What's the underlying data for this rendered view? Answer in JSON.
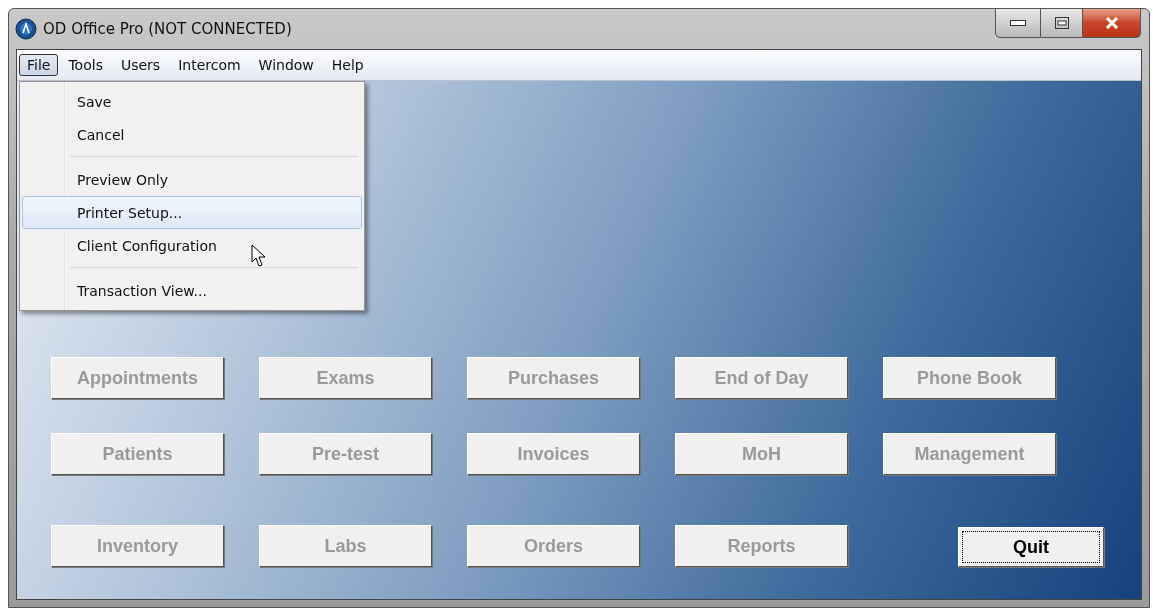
{
  "window": {
    "title": "OD Office Pro (NOT CONNECTED)"
  },
  "menu_bar": [
    {
      "label": "File",
      "selected": true
    },
    {
      "label": "Tools",
      "selected": false
    },
    {
      "label": "Users",
      "selected": false
    },
    {
      "label": "Intercom",
      "selected": false
    },
    {
      "label": "Window",
      "selected": false
    },
    {
      "label": "Help",
      "selected": false
    }
  ],
  "file_menu": [
    {
      "kind": "item",
      "label": "Save",
      "selected": false
    },
    {
      "kind": "item",
      "label": "Cancel",
      "selected": false
    },
    {
      "kind": "separator"
    },
    {
      "kind": "item",
      "label": "Preview Only",
      "selected": false
    },
    {
      "kind": "item",
      "label": "Printer Setup...",
      "selected": true
    },
    {
      "kind": "item",
      "label": "Client Configuration",
      "selected": false
    },
    {
      "kind": "separator"
    },
    {
      "kind": "item",
      "label": "Transaction View...",
      "selected": false
    }
  ],
  "button_rows": [
    [
      {
        "label": "Appointments",
        "disabled": true,
        "focused": false
      },
      {
        "label": "Exams",
        "disabled": true,
        "focused": false
      },
      {
        "label": "Purchases",
        "disabled": true,
        "focused": false
      },
      {
        "label": "End of Day",
        "disabled": true,
        "focused": false
      },
      {
        "label": "Phone Book",
        "disabled": true,
        "focused": false
      }
    ],
    [
      {
        "label": "Patients",
        "disabled": true,
        "focused": false
      },
      {
        "label": "Pre-test",
        "disabled": true,
        "focused": false
      },
      {
        "label": "Invoices",
        "disabled": true,
        "focused": false
      },
      {
        "label": "MoH",
        "disabled": true,
        "focused": false
      },
      {
        "label": "Management",
        "disabled": true,
        "focused": false
      }
    ],
    [
      {
        "label": "Inventory",
        "disabled": true,
        "focused": false
      },
      {
        "label": "Labs",
        "disabled": true,
        "focused": false
      },
      {
        "label": "Orders",
        "disabled": true,
        "focused": false
      },
      {
        "label": "Reports",
        "disabled": true,
        "focused": false
      },
      {
        "label": "Quit",
        "disabled": false,
        "focused": true
      }
    ]
  ]
}
